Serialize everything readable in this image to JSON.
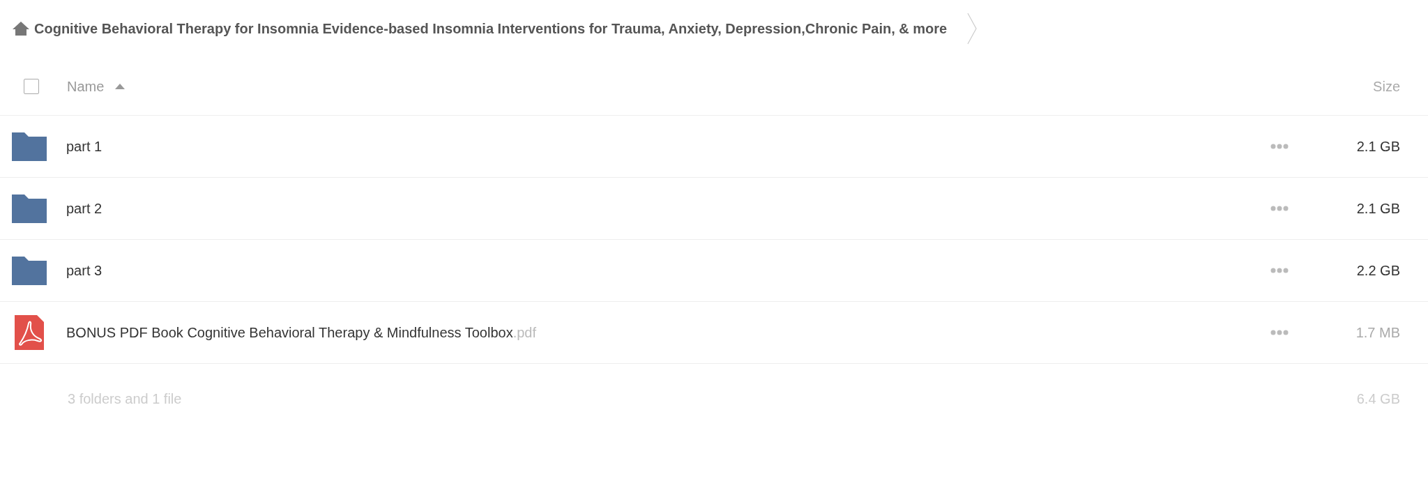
{
  "breadcrumb": {
    "title": "Cognitive Behavioral Therapy for Insomnia Evidence-based Insomnia Interventions for Trauma, Anxiety, Depression,Chronic Pain, & more"
  },
  "header": {
    "select_all": {
      "checked": false
    },
    "columns": [
      {
        "label": "Name",
        "sorted": true
      },
      {
        "label": "Size",
        "sorted": false
      }
    ]
  },
  "rows": [
    {
      "kind": "folder",
      "name": "part 1",
      "size": "2.1 GB"
    },
    {
      "kind": "folder",
      "name": "part 2",
      "size": "2.1 GB"
    },
    {
      "kind": "folder",
      "name": "part 3",
      "size": "2.2 GB"
    },
    {
      "kind": "pdf",
      "name": "BONUS PDF Book Cognitive Behavioral Therapy & Mindfulness Toolbox",
      "extension": ".pdf",
      "size": "1.7 MB"
    }
  ],
  "summary": {
    "count": "3 folders and 1 file",
    "total": "6.4 GB"
  }
}
